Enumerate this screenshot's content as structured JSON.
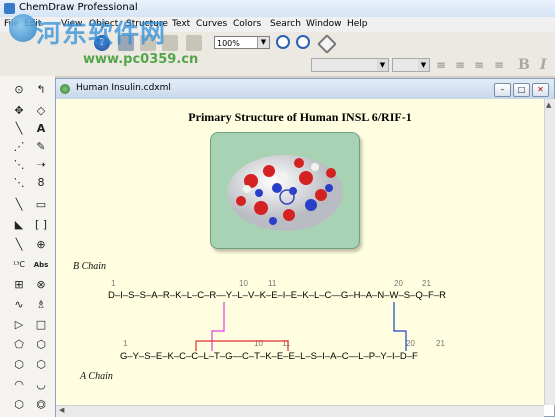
{
  "app": {
    "title": "ChemDraw Professional"
  },
  "menu": [
    "File",
    "Edit",
    "View",
    "Object",
    "Structure",
    "Text",
    "Curves",
    "Colors",
    "Search",
    "Window",
    "Help"
  ],
  "toolbar": {
    "zoom": "100%"
  },
  "document": {
    "tab_title": "Human Insulin.cdxml",
    "heading": "Primary Structure of Human INSL 6/RIF-1",
    "b_chain_label": "B Chain",
    "a_chain_label": "A Chain",
    "b_chain_seq": "D–I–S–S–A–R–K–L–C–R—Y–L–V–K–E–I–E–K–L–C—G–H–A–N–W–S–Q–F–R",
    "a_chain_seq": "G–Y–S–E–K–C–C–L–T–G—C–T–K–E–E–L–S–I–A–C—L–P–Y–I–D–F",
    "b_numbers": [
      "1",
      "10",
      "11",
      "20",
      "21"
    ],
    "a_numbers": [
      "1",
      "10",
      "11",
      "20",
      "21"
    ]
  },
  "watermark": {
    "brand": "河东软件网",
    "url": "www.pc0359.cn"
  },
  "colors": {
    "bridge_pink": "#e040e0",
    "bridge_blue": "#2040d0",
    "bridge_red": "#e03030",
    "cys_blue": "#1a3fd0",
    "cys_pink": "#d020d0",
    "cys_red": "#d02020"
  }
}
